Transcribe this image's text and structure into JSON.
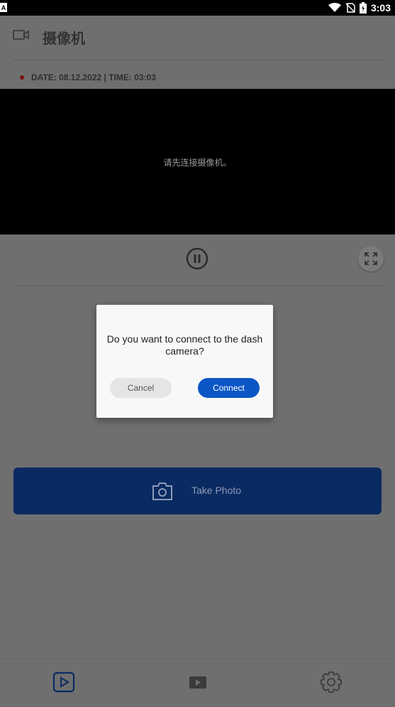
{
  "status_bar": {
    "indicator": "A",
    "time": "3:03",
    "icons": [
      "wifi-icon",
      "no-sim-icon",
      "battery-icon"
    ]
  },
  "app_bar": {
    "title": "摄像机",
    "icon": "video-camera-icon"
  },
  "recording": {
    "date_time": "DATE: 08.12.2022 | TIME: 03:03",
    "indicator_color": "#7a1010"
  },
  "video": {
    "message": "请先连接摄像机。"
  },
  "controls": {
    "pause_icon": "pause-icon",
    "fullscreen_icon": "fullscreen-icon"
  },
  "dialog": {
    "message": "Do you want to connect to the dash camera?",
    "cancel_label": "Cancel",
    "connect_label": "Connect",
    "accent": "#0b56c6"
  },
  "photo": {
    "label": "Take Photo",
    "icon": "camera-icon",
    "color": "#0a2a62"
  },
  "bottom_nav": {
    "items": [
      "live-view-icon",
      "playback-icon",
      "settings-icon"
    ]
  }
}
